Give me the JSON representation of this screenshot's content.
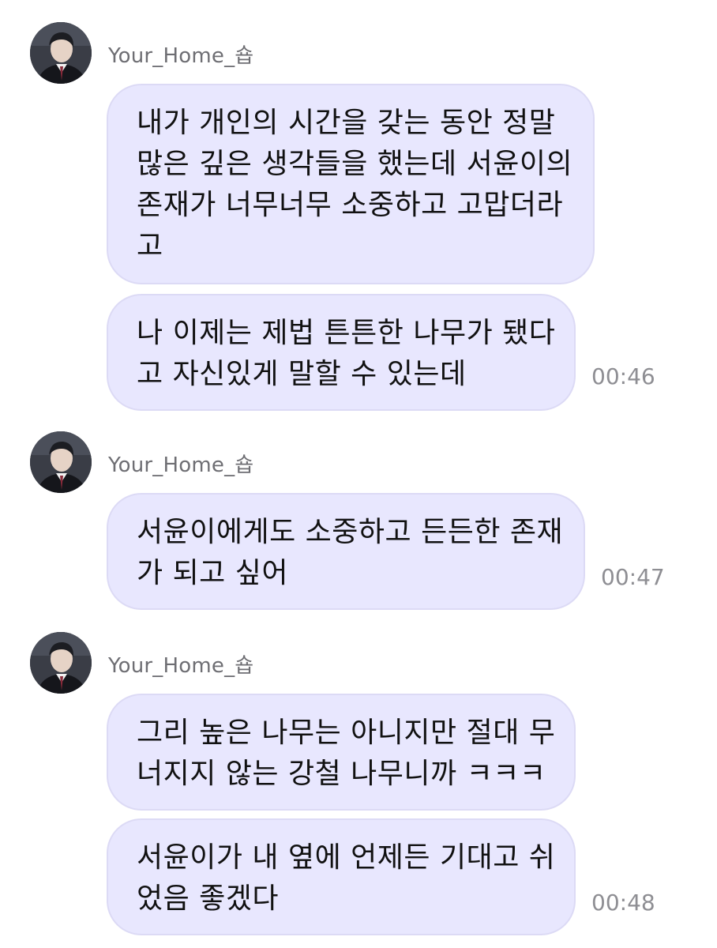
{
  "sender_name": "Your_Home_숍",
  "groups": [
    {
      "messages": [
        {
          "lines": [
            "내가 개인의 시간을 갖는 동안 정말",
            "많은 깊은 생각들을 했는데 서윤이의",
            "존재가 너무너무 소중하고 고맙더라",
            "고"
          ]
        },
        {
          "lines": [
            "나 이제는 제법 튼튼한 나무가 됐다",
            "고 자신있게 말할 수 있는데"
          ],
          "time": "00:46"
        }
      ]
    },
    {
      "messages": [
        {
          "lines": [
            "서윤이에게도 소중하고 든든한 존재",
            "가 되고 싶어"
          ],
          "time": "00:47"
        }
      ]
    },
    {
      "messages": [
        {
          "lines": [
            "그리 높은 나무는 아니지만 절대 무",
            "너지지 않는 강철 나무니까 ㅋㅋㅋ"
          ]
        },
        {
          "lines": [
            "서윤이가 내 옆에 언제든 기대고 쉬",
            "었음 좋겠다"
          ],
          "time": "00:48"
        }
      ]
    }
  ]
}
